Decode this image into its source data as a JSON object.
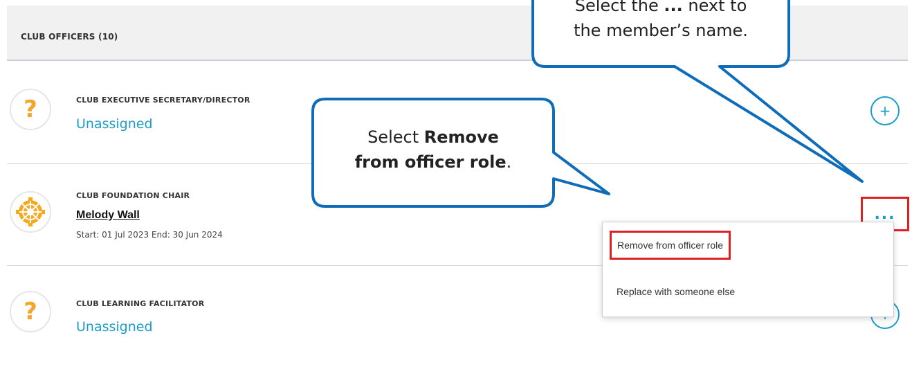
{
  "section": {
    "title": "CLUB OFFICERS (10)"
  },
  "rows": [
    {
      "role": "CLUB EXECUTIVE SECRETARY/DIRECTOR",
      "status": "Unassigned",
      "icon": "question-icon"
    },
    {
      "role": "CLUB FOUNDATION CHAIR",
      "member": "Melody Wall",
      "term": "Start: 01 Jul 2023 End: 30 Jun 2024",
      "icon": "rotary-wheel-icon"
    },
    {
      "role": "CLUB LEARNING FACILITATOR",
      "status": "Unassigned",
      "icon": "question-icon"
    }
  ],
  "actions": {
    "add_icon": "plus-icon",
    "more_label": "..."
  },
  "menu": {
    "items": [
      {
        "label": "Remove from officer role"
      },
      {
        "label": "Replace with someone else"
      }
    ]
  },
  "callouts": {
    "top": {
      "line1_pre": "Select the ",
      "line1_bold": "...",
      "line1_post": " next to",
      "line2": "the member’s name."
    },
    "middle": {
      "line1_pre": "Select ",
      "line1_bold": "Remove",
      "line2_bold": "from officer role",
      "line2_post": "."
    }
  },
  "colors": {
    "accent": "#1b9dc9",
    "callout_border": "#0e6cb8",
    "highlight": "#e02020",
    "question": "#f4a52b",
    "rotary": "#f7a81b"
  }
}
